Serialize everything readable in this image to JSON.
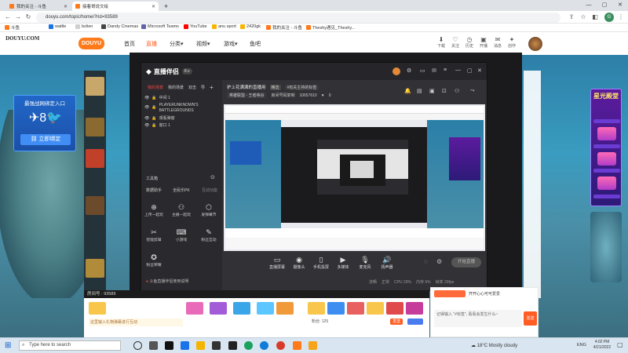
{
  "browser": {
    "tabs": [
      {
        "label": "我的关注 - 斗鱼",
        "active": false
      },
      {
        "label": "接着哥说文绘",
        "active": true
      }
    ],
    "new_tab": "+",
    "window_controls": [
      "—",
      "▢",
      "✕"
    ],
    "url": "douyu.com/topic/homei?rid=93589",
    "bookmarks": [
      "斗鱼",
      "wattle",
      "bzlien",
      "Dandy Cinemas",
      "Microsoft Teams",
      "YouTube",
      "anu sport",
      "2420gk",
      "我的关注 - 斗鱼",
      "Theshy遇见_Theshy..."
    ]
  },
  "site": {
    "logo": "DOUYU 斗鱼",
    "nav": [
      "首页",
      "直播",
      "分类▾",
      "视频▾",
      "游戏▾",
      "鱼吧"
    ],
    "active_nav": "直播",
    "top_icons": [
      "下载",
      "关注",
      "历史",
      "开播",
      "消息",
      "创作"
    ]
  },
  "page": {
    "promo_title": "最強战网绑定入口",
    "promo_button": "立即绑定",
    "right_banner_title": "星光殿堂",
    "room_id_text": "93589",
    "watermark": "DOUYU.COM"
  },
  "software": {
    "title": "直播伴侣",
    "version_badge": "8.x",
    "sidebar_tabs": [
      "我的场景",
      "我的场景",
      "双击",
      "导"
    ],
    "scenes": [
      "中间 1",
      "PLAYERUNKNOWN'S BATTLEGROUNDS",
      "观看弹窗",
      "窗口 1"
    ],
    "tools_header": "工具箱",
    "tool_tabs": [
      "数据助手",
      "全民乐PK",
      "互动功能"
    ],
    "tools": [
      "上传一起玩",
      "主播一起玩",
      "发弹幕节",
      "智能剪辑",
      "小游戏",
      "粉丝互动",
      "粉丝荣耀"
    ],
    "stream_title": "护上花满满的直播用",
    "badge": "精选",
    "tags": [
      "#有关主持的标签"
    ],
    "category": "英雄联盟 - 王者峡谷",
    "room_link": "房间号码复制",
    "viewer_count": "10657610",
    "like_count": "0",
    "bottom_controls": [
      "直播屏幕",
      "摄像头",
      "手机投屏",
      "多媒体",
      "麦克风",
      "扬声器"
    ],
    "start_button": "开始直播",
    "status_bar": [
      "流畅",
      "正常",
      "CPU 29%",
      "内存 6%",
      "帧率 29fps"
    ],
    "notice": "斗鱼直播伴侣使用说明"
  },
  "bottom": {
    "chat_placeholder": "这里输入礼物弹幕进行互动",
    "send_button": "发送",
    "fans_text": "粉丝: 125",
    "chat_message": "记得输入 \"#标签\", 看看会发生什么~",
    "chat_header": "开开心心可可爱爱",
    "room_label": "房间号"
  },
  "taskbar": {
    "search": "Type here to search",
    "weather": "18°C  Mostly cloudy",
    "lang": "ENG",
    "time": "4:02 PM",
    "date": "4/21/2022"
  }
}
